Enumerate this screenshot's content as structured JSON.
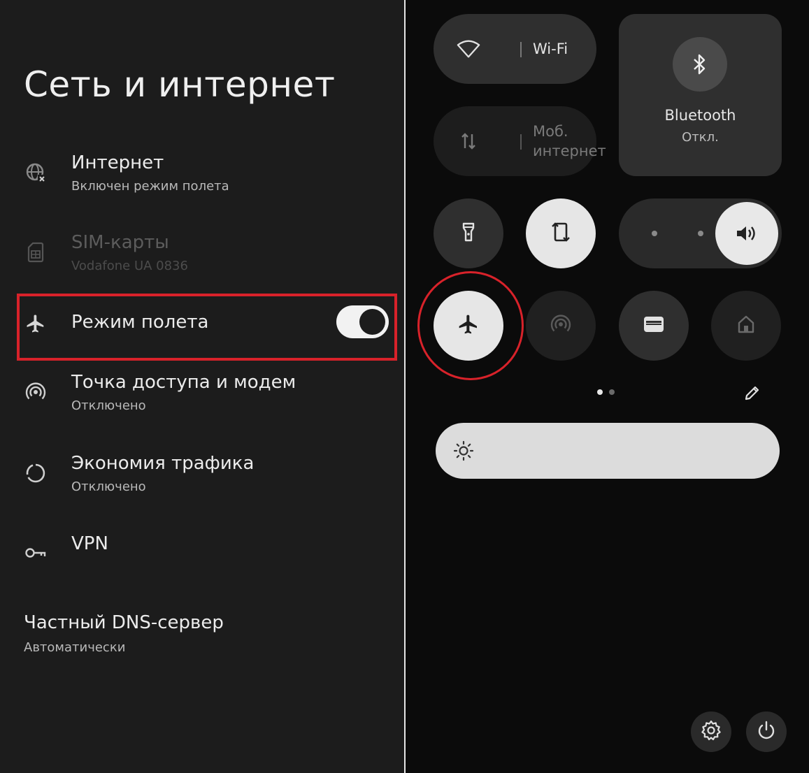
{
  "settings": {
    "title": "Сеть и интернет",
    "items": [
      {
        "title": "Интернет",
        "subtitle": "Включен режим полета",
        "icon": "globe-off-icon"
      },
      {
        "title": "SIM-карты",
        "subtitle": "Vodafone UA 0836",
        "icon": "sim-card-icon"
      },
      {
        "title": "Режим полета",
        "subtitle": "",
        "icon": "airplane-icon",
        "toggle": true
      },
      {
        "title": "Точка доступа и модем",
        "subtitle": "Отключено",
        "icon": "hotspot-icon"
      },
      {
        "title": "Экономия трафика",
        "subtitle": "Отключено",
        "icon": "data-saver-icon"
      },
      {
        "title": "VPN",
        "subtitle": "",
        "icon": "vpn-key-icon"
      },
      {
        "title": "Частный DNS-сервер",
        "subtitle": "Автоматически",
        "icon": ""
      }
    ],
    "highlight_color": "#d8222a"
  },
  "quick_settings": {
    "wifi": {
      "label": "Wi-Fi",
      "icon": "wifi-icon"
    },
    "mobile": {
      "label_line1": "Моб.",
      "label_line2": "интернет",
      "icon": "mobile-data-icon"
    },
    "bluetooth": {
      "label": "Bluetooth",
      "state": "Откл.",
      "icon": "bluetooth-icon"
    },
    "tiles": [
      "flashlight-icon",
      "auto-rotate-icon",
      "volume-icon",
      "airplane-icon",
      "hotspot-icon",
      "wallet-icon",
      "home-icon"
    ],
    "edit_icon": "pencil-icon",
    "brightness_icon": "sun-icon",
    "settings_icon": "gear-icon",
    "power_icon": "power-icon"
  }
}
